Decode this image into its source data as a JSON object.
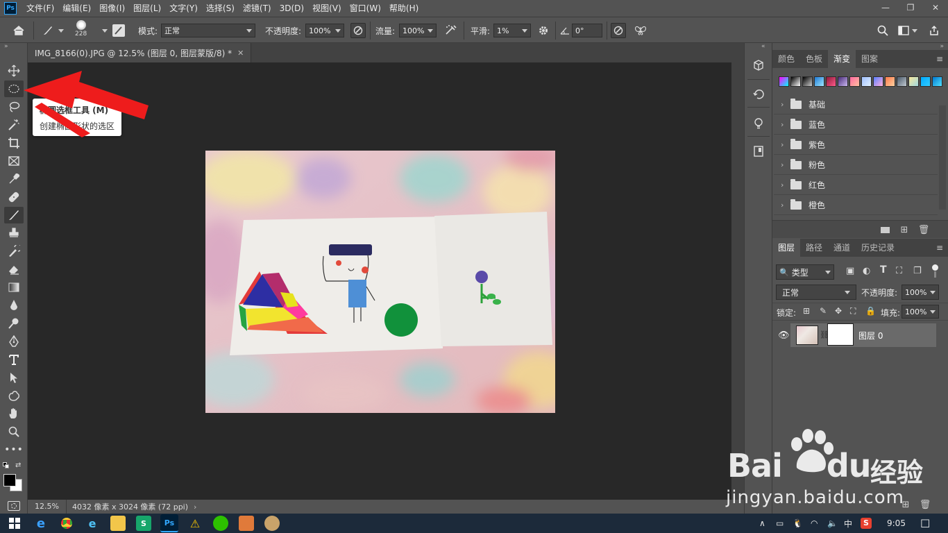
{
  "app": {
    "logo": "Ps"
  },
  "menu": [
    "文件(F)",
    "编辑(E)",
    "图像(I)",
    "图层(L)",
    "文字(Y)",
    "选择(S)",
    "滤镜(T)",
    "3D(D)",
    "视图(V)",
    "窗口(W)",
    "帮助(H)"
  ],
  "options": {
    "brush_size": "228",
    "mode_label": "模式:",
    "mode_value": "正常",
    "opacity_label": "不透明度:",
    "opacity_value": "100%",
    "flow_label": "流量:",
    "flow_value": "100%",
    "smooth_label": "平滑:",
    "smooth_value": "1%",
    "angle_value": "0°"
  },
  "document": {
    "tab_title": "IMG_8166(0).JPG @ 12.5% (图层 0, 图层蒙版/8) *",
    "zoom": "12.5%",
    "dimensions": "4032 像素 x 3024 像素 (72 ppi)"
  },
  "tooltip": {
    "title": "椭圆选框工具 (M)",
    "description": "创建椭圆形状的选区"
  },
  "gradient_panel": {
    "tabs": [
      "颜色",
      "色板",
      "渐变",
      "图案"
    ],
    "active_tab": "渐变",
    "folders": [
      "基础",
      "蓝色",
      "紫色",
      "粉色",
      "红色",
      "橙色"
    ]
  },
  "layers_panel": {
    "tabs": [
      "图层",
      "路径",
      "通道",
      "历史记录"
    ],
    "filter_label": "类型",
    "blend_mode": "正常",
    "opacity_label": "不透明度:",
    "opacity_value": "100%",
    "lock_label": "锁定:",
    "fill_label": "填充:",
    "fill_value": "100%",
    "layer_name": "图层 0"
  },
  "taskbar": {
    "time": "9:05",
    "ime": "中"
  },
  "watermark": {
    "brand": "Bai",
    "brand2": "du",
    "suffix": "经验",
    "url": "jingyan.baidu.com"
  },
  "colors": {
    "panel": "#535353",
    "canvas": "#282828",
    "accent": "#31a8ff",
    "arrow": "#ee1c1c"
  }
}
